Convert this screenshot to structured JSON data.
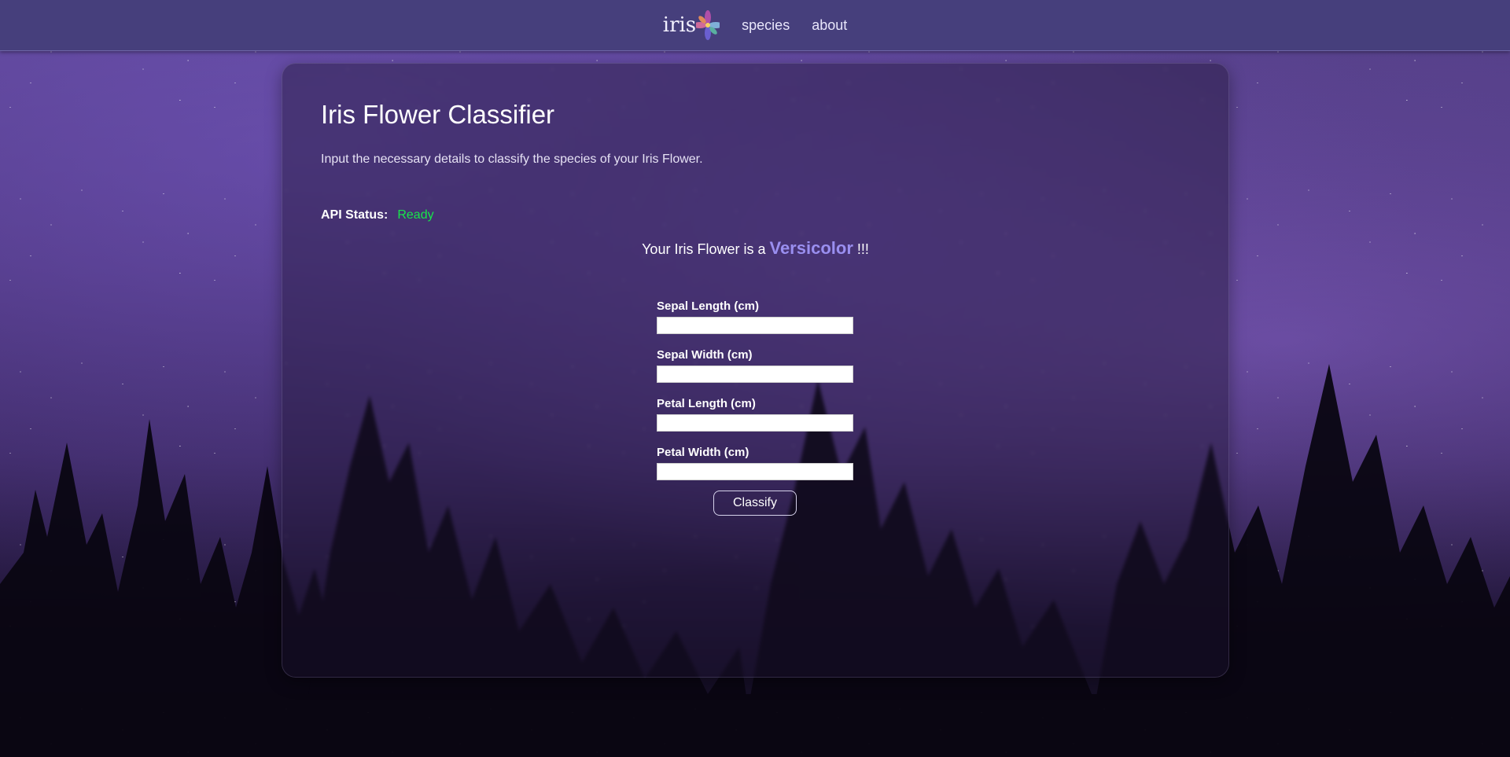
{
  "nav": {
    "brand": "iris",
    "links": [
      "species",
      "about"
    ]
  },
  "main": {
    "title": "Iris Flower Classifier",
    "subtitle": "Input the necessary details to classify the species of your Iris Flower.",
    "api_status": {
      "label": "API Status:",
      "value": "Ready",
      "color": "#17e64a"
    },
    "result": {
      "prefix": "Your Iris Flower is a",
      "species": "Versicolor",
      "suffix": "!!!"
    },
    "form": {
      "fields": [
        {
          "label": "Sepal Length (cm)",
          "value": ""
        },
        {
          "label": "Sepal Width (cm)",
          "value": ""
        },
        {
          "label": "Petal Length (cm)",
          "value": ""
        },
        {
          "label": "Petal Width (cm)",
          "value": ""
        }
      ],
      "submit_label": "Classify"
    }
  },
  "colors": {
    "navbar": "#463f7c",
    "accent": "#9a8ff0",
    "status_ready": "#17e64a"
  }
}
